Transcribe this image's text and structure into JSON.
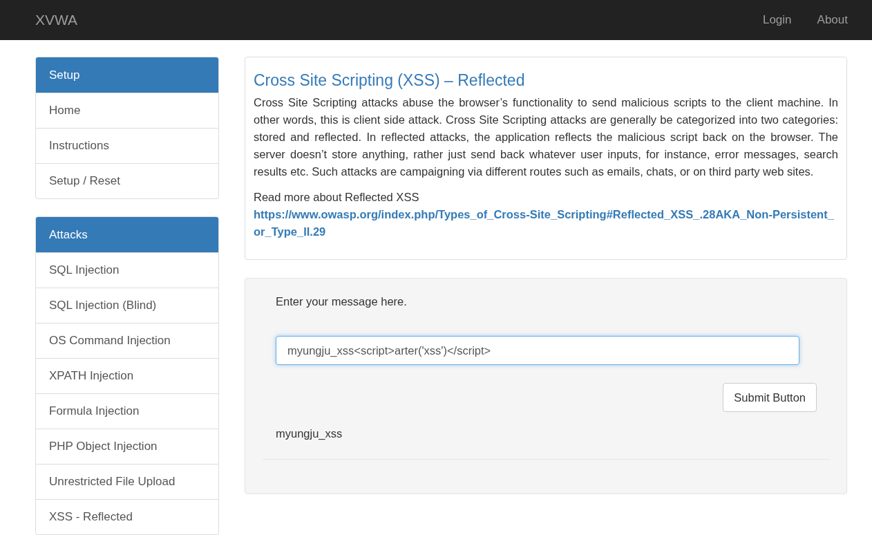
{
  "navbar": {
    "brand": "XVWA",
    "links": [
      "Login",
      "About"
    ]
  },
  "sidebar": [
    {
      "heading": "Setup",
      "items": [
        "Home",
        "Instructions",
        "Setup / Reset"
      ]
    },
    {
      "heading": "Attacks",
      "items": [
        "SQL Injection",
        "SQL Injection (Blind)",
        "OS Command Injection",
        "XPATH Injection",
        "Formula Injection",
        "PHP Object Injection",
        "Unrestricted File Upload",
        "XSS - Reflected"
      ]
    }
  ],
  "info": {
    "title": "Cross Site Scripting (XSS) – Reflected",
    "description": "Cross Site Scripting attacks abuse the browser’s functionality to send malicious scripts to the client machine. In other words, this is client side attack. Cross Site Scripting attacks are generally be categorized into two categories: stored and reflected. In reflected attacks, the application reflects the malicious script back on the browser. The server doesn’t store anything, rather just send back whatever user inputs, for instance, error messages, search results etc. Such attacks are campaigning via different routes such as emails, chats, or on third party web sites.",
    "read_more": "Read more about Reflected XSS",
    "link": "https://www.owasp.org/index.php/Types_of_Cross-Site_Scripting#Reflected_XSS_.28AKA_Non-Persistent_or_Type_II.29"
  },
  "form": {
    "label": "Enter your message here.",
    "value": "myungju_xss<script>arter('xss')</script>",
    "button": "Submit Button",
    "output": "myungju_xss"
  }
}
